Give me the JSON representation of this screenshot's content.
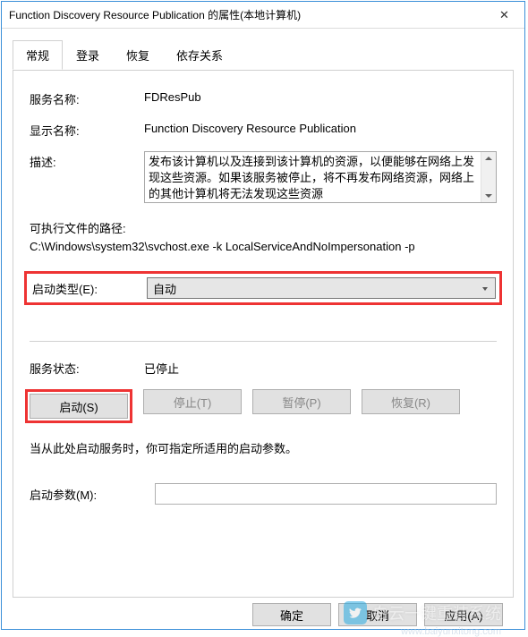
{
  "window": {
    "title": "Function Discovery Resource Publication 的属性(本地计算机)",
    "close": "✕"
  },
  "tabs": {
    "general": "常规",
    "logon": "登录",
    "recovery": "恢复",
    "dependencies": "依存关系"
  },
  "general": {
    "service_name_label": "服务名称:",
    "service_name": "FDResPub",
    "display_name_label": "显示名称:",
    "display_name": "Function Discovery Resource Publication",
    "description_label": "描述:",
    "description": "发布该计算机以及连接到该计算机的资源，以便能够在网络上发现这些资源。如果该服务被停止，将不再发布网络资源，网络上的其他计算机将无法发现这些资源",
    "exe_path_label": "可执行文件的路径:",
    "exe_path": "C:\\Windows\\system32\\svchost.exe -k LocalServiceAndNoImpersonation -p",
    "startup_type_label": "启动类型(E):",
    "startup_type": "自动",
    "status_label": "服务状态:",
    "status": "已停止",
    "btn_start": "启动(S)",
    "btn_stop": "停止(T)",
    "btn_pause": "暂停(P)",
    "btn_resume": "恢复(R)",
    "hint": "当从此处启动服务时，你可指定所适用的启动参数。",
    "start_params_label": "启动参数(M):",
    "start_params": ""
  },
  "footer": {
    "ok": "确定",
    "cancel": "取消",
    "apply": "应用(A)"
  },
  "watermark": {
    "text": "白云一键重装系统",
    "url": "www.baiyunxitong.com"
  }
}
